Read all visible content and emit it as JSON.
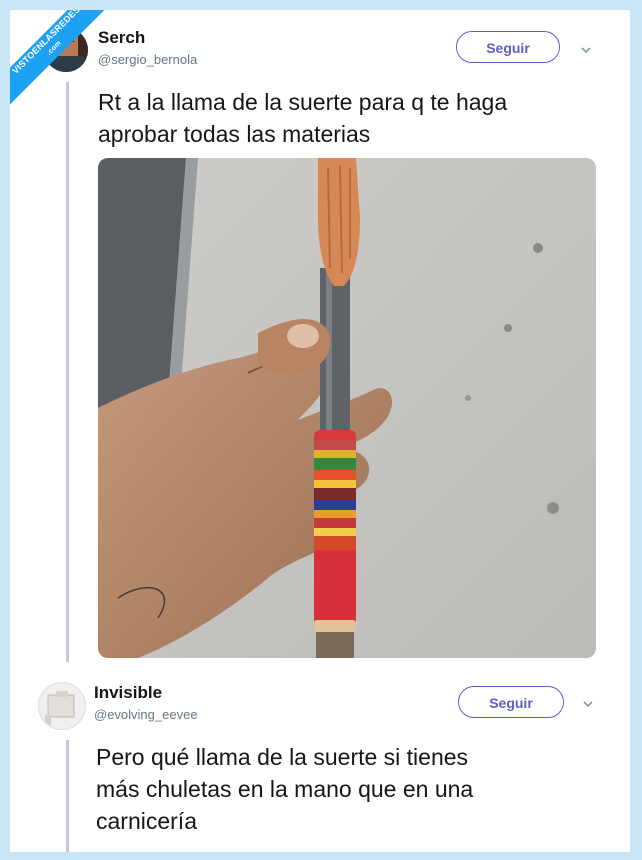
{
  "watermark": {
    "line1": "VISTOENLASREDES",
    "line2": ".com"
  },
  "tweets": [
    {
      "name": "Serch",
      "handle": "@sergio_bernola",
      "follow_label": "Seguir",
      "text_lines": [
        "Rt a la llama de la suerte para q te haga",
        "aprobar todas las materias"
      ]
    },
    {
      "name": "Invisible",
      "handle": "@evolving_eevee",
      "follow_label": "Seguir",
      "text_lines": [
        "Pero qué llama de la suerte si tienes",
        "más chuletas en la mano que en una",
        "carnicería"
      ]
    }
  ],
  "colors": {
    "follow": "#5b5fc7",
    "thread": "#c9c3e8",
    "background": "#c9e6f7"
  }
}
